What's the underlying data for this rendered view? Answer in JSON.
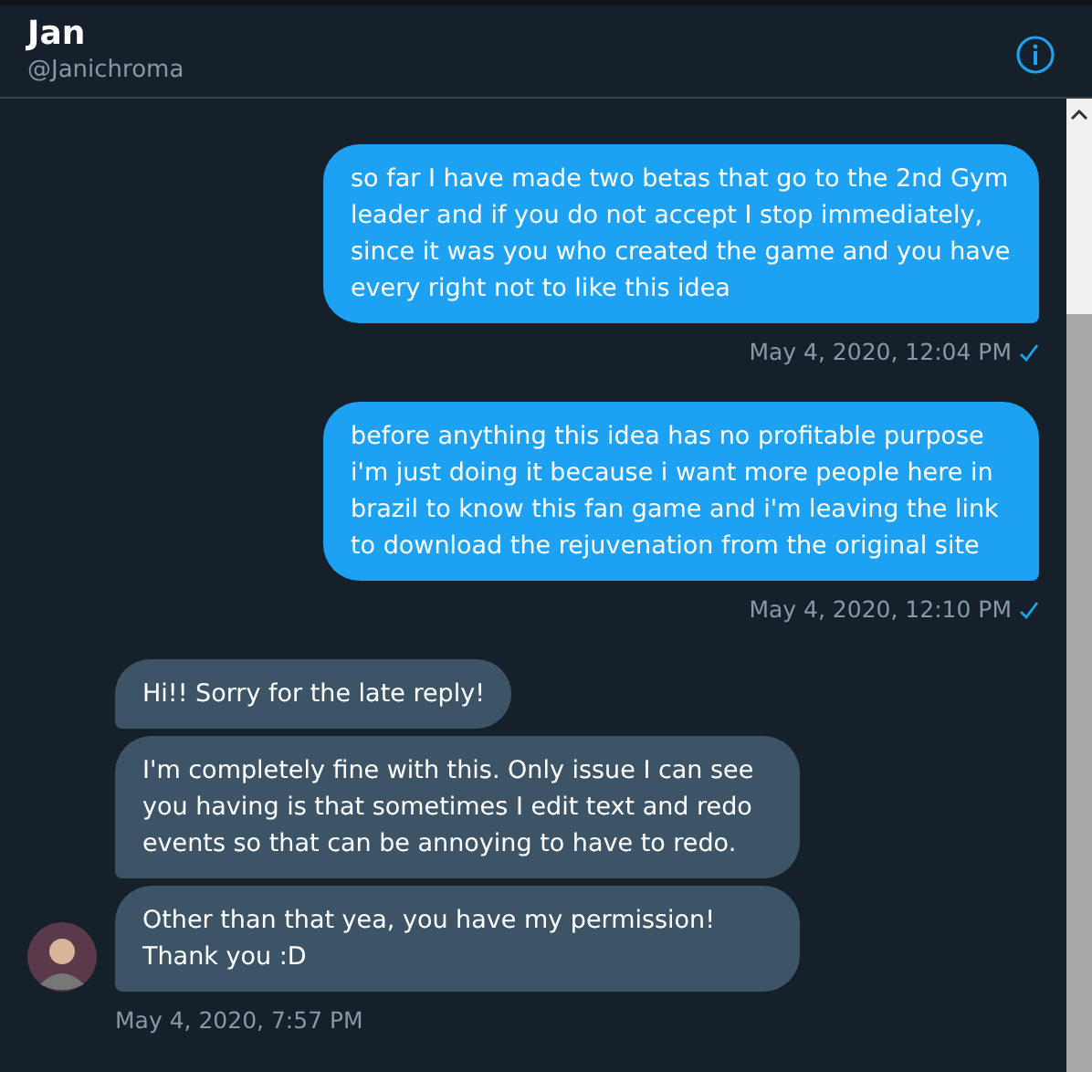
{
  "header": {
    "name": "Jan",
    "handle": "@Janichroma"
  },
  "messages": [
    {
      "kind": "sent",
      "bubbles": [
        "so far I have made two betas that go to the 2nd Gym leader and if you do not accept I stop immediately, since it was you who created the game and you have every right not to like this idea"
      ],
      "time": "May 4, 2020, 12:04 PM",
      "read": true
    },
    {
      "kind": "sent",
      "bubbles": [
        "before anything this idea has no profitable purpose i'm just doing it because i want more people here in brazil to know this fan game and i'm leaving the link to download the rejuvenation from the original site"
      ],
      "time": "May 4, 2020, 12:10 PM",
      "read": true
    },
    {
      "kind": "received",
      "bubbles": [
        "Hi!! Sorry for the late reply!",
        "I'm completely fine with this. Only issue I can see you having is that sometimes I edit text and redo events so that can be annoying to have to redo.",
        "Other than that yea, you have my permission! Thank you :D"
      ],
      "time": "May 4, 2020, 7:57 PM"
    }
  ]
}
